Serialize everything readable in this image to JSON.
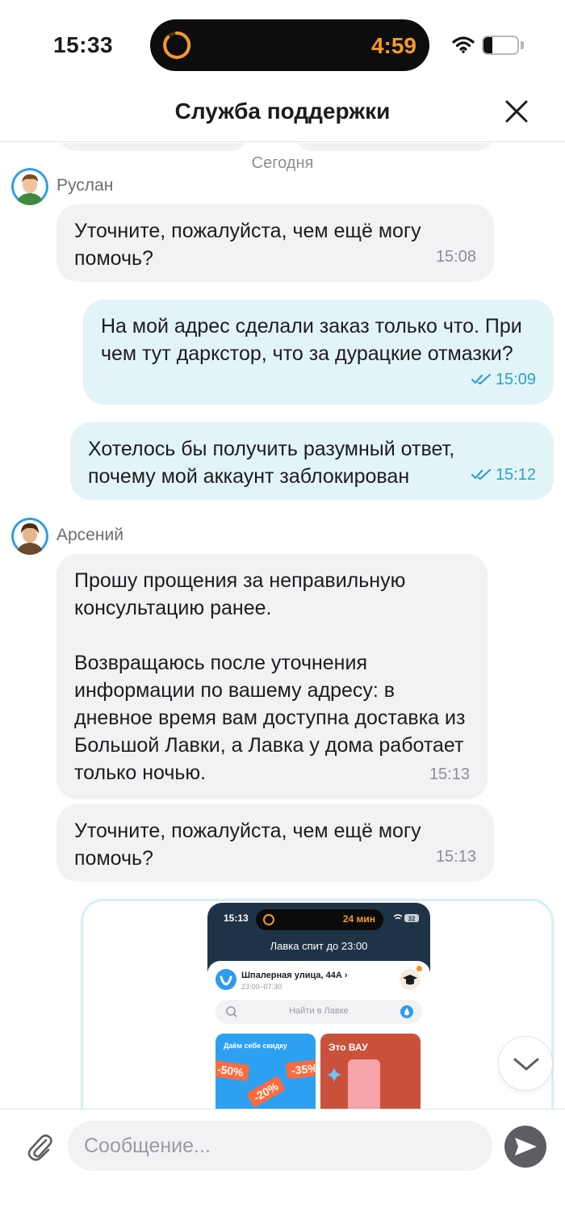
{
  "status_bar": {
    "time": "15:33",
    "island_timer": "4:59",
    "battery_level": "27",
    "battery_fraction": 0.27
  },
  "header": {
    "title": "Служба поддержки",
    "close_icon": "close-icon"
  },
  "chat": {
    "date_separator": "Сегодня",
    "messages": [
      {
        "sender": "Руслан",
        "direction": "in",
        "text": "Уточните, пожалуйста, чем ещё могу помочь?",
        "time": "15:08"
      },
      {
        "direction": "out",
        "text": "На мой адрес сделали заказ только что. При чем тут даркстор, что за дурацкие отмазки?",
        "time": "15:09"
      },
      {
        "direction": "out",
        "text": "Хотелось бы получить разумный ответ, почему мой аккаунт заблокирован",
        "time": "15:12"
      },
      {
        "sender": "Арсений",
        "direction": "in",
        "text": "Прошу прощения за неправильную консультацию ранее.\n\nВозвращаюсь после уточнения информации по вашему адресу: в дневное время вам доступна доставка из Большой Лавки, а Лавка у дома работает только ночью.",
        "time": "15:13"
      },
      {
        "direction": "in",
        "text": "Уточните, пожалуйста, чем ещё могу помочь?",
        "time": "15:13"
      }
    ],
    "attachment": {
      "time": "15:13",
      "island_text": "24 мин",
      "battery": "32",
      "banner": "Лавка спит до 23:00",
      "address": "Шпалерная улица, 44А ›",
      "hours": "23:00–07:30",
      "search_placeholder": "Найти в Лавке",
      "promo1_title": "Даём себе скидку",
      "promo1_tags": [
        "-50%",
        "-35%",
        "-20%"
      ],
      "promo2_title": "Это ВАУ"
    }
  },
  "composer": {
    "placeholder": "Сообщение...",
    "attach_icon": "paperclip-icon",
    "send_icon": "send-icon"
  },
  "colors": {
    "incoming_bubble": "#f2f2f5",
    "outgoing_bubble": "#e2f4f8",
    "read_ticks": "#2aa3c5",
    "island_timer": "#f39a2c"
  }
}
